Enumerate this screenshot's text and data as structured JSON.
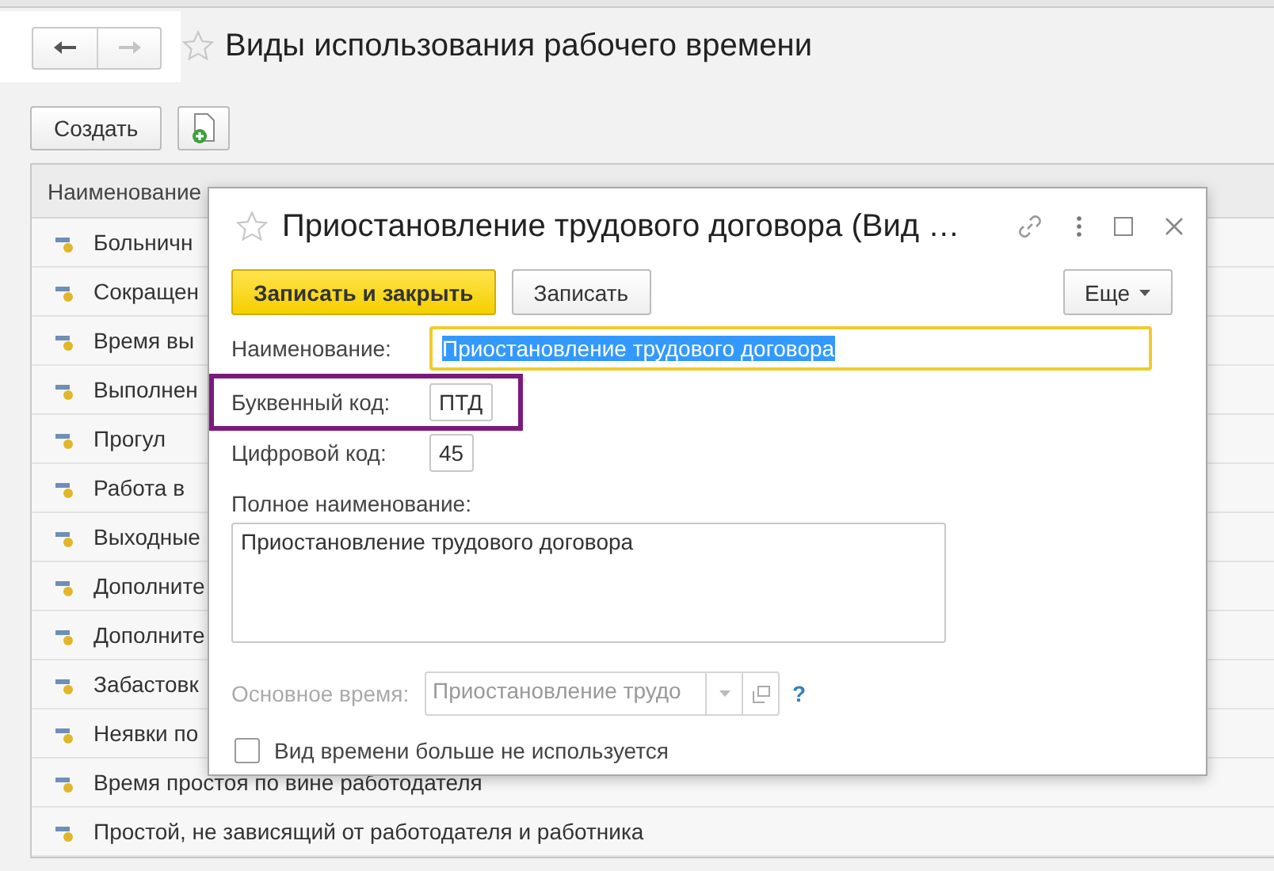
{
  "window": {
    "title": "Виды использования рабочего времени",
    "favorite": false
  },
  "toolbar": {
    "create_button": "Создать"
  },
  "list": {
    "columns": [
      "Наименование"
    ],
    "rows": [
      {
        "name": "Больничн"
      },
      {
        "name": "Сокращен"
      },
      {
        "name": "Время вы"
      },
      {
        "name": "Выполнен"
      },
      {
        "name": "Прогул"
      },
      {
        "name": "Работа в"
      },
      {
        "name": "Выходные"
      },
      {
        "name": "Дополните"
      },
      {
        "name": "Дополните"
      },
      {
        "name": "Забастовк"
      },
      {
        "name": "Неявки по"
      },
      {
        "name": "Время простоя по вине работодателя"
      },
      {
        "name": "Простой, не зависящий от работодателя и работника"
      }
    ]
  },
  "dialog": {
    "title": "Приостановление трудового договора (Вид …",
    "favorite": false,
    "buttons": [
      {
        "label": "Записать и закрыть",
        "kind": "primary"
      },
      {
        "label": "Записать",
        "kind": "normal"
      }
    ],
    "more_button": "Еще",
    "fields": [
      {
        "kind": "text",
        "label": "Наименование:",
        "value": "Приостановление трудового договора",
        "focused": true,
        "text_selected": true,
        "highlighted": false
      },
      {
        "kind": "short",
        "label": "Буквенный код:",
        "value": "ПТД",
        "focused": false,
        "text_selected": false,
        "highlighted": true
      },
      {
        "kind": "short",
        "label": "Цифровой код:",
        "value": "45",
        "focused": false,
        "text_selected": false,
        "highlighted": false
      },
      {
        "kind": "area",
        "label": "Полное наименование:",
        "value": "Приостановление трудового договора"
      },
      {
        "kind": "combo",
        "label": "Основное время:",
        "value": "Приостановление трудо",
        "disabled": true,
        "help": "?"
      },
      {
        "kind": "checkbox",
        "label": "Вид времени больше не используется",
        "checked": false
      }
    ]
  }
}
